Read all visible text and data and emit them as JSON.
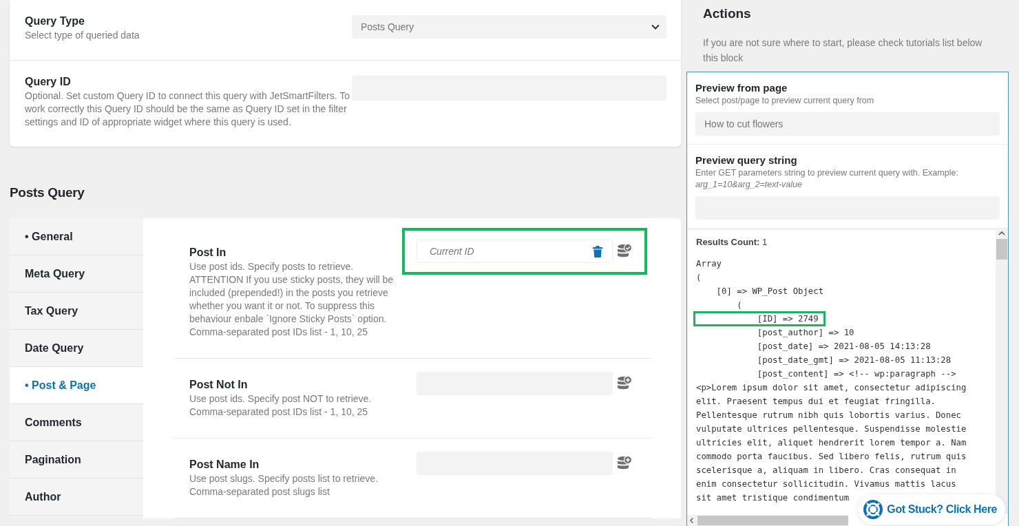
{
  "settings": [
    {
      "title": "Query Type",
      "description": "Select type of queried data",
      "kind": "select",
      "value": "Posts Query"
    },
    {
      "title": "Query ID",
      "description": "Optional. Set custom Query ID to connect this query with JetSmartFilters. To work correctly this Query ID should be the same as Query ID set in the filter settings and ID of appropriate widget where this query is used.",
      "kind": "text"
    }
  ],
  "section_title": "Posts Query",
  "tabs": [
    {
      "label": "• General",
      "selected": false
    },
    {
      "label": "Meta Query",
      "selected": false
    },
    {
      "label": "Tax Query",
      "selected": false
    },
    {
      "label": "Date Query",
      "selected": false
    },
    {
      "label": "• Post & Page",
      "selected": true
    },
    {
      "label": "Comments",
      "selected": false
    },
    {
      "label": "Pagination",
      "selected": false
    },
    {
      "label": "Author",
      "selected": false
    }
  ],
  "fields": [
    {
      "title": "Post In",
      "description": "Use post ids. Specify posts to retrieve. ATTENTION If you use sticky posts, they will be included (prepended!) in the posts you retrieve whether you want it or not. To suppress this behaviour enbale `Ignore Sticky Posts` option. Comma-separated post IDs list - 1, 10, 25",
      "value": "Current ID",
      "macro_applied": true,
      "highlighted": true
    },
    {
      "title": "Post Not In",
      "description": "Use post ids. Specify post NOT to retrieve. Comma-separated post IDs list - 1, 10, 25",
      "macro_applied": false,
      "highlighted": false
    },
    {
      "title": "Post Name In",
      "description": "Use post slugs. Specify posts list to retrieve. Comma-separated post slugs list",
      "macro_applied": false,
      "highlighted": false
    }
  ],
  "actions": {
    "title": "Actions",
    "description": "If you are not sure where to start, please check tutorials list below this block"
  },
  "preview_page": {
    "title": "Preview from page",
    "description": "Select post/page to preview current query from",
    "value": "How to cut flowers"
  },
  "preview_query": {
    "title": "Preview query string",
    "description": "Enter GET parameters string to preview current query with. Example:",
    "example": "arg_1=10&arg_2=text-value"
  },
  "results": {
    "label": "Results Count:",
    "count": "1",
    "lines": [
      {
        "text": "Array",
        "highlighted": false
      },
      {
        "text": "(",
        "highlighted": false
      },
      {
        "text": "    [0] => WP_Post Object",
        "highlighted": false
      },
      {
        "text": "        (",
        "highlighted": false
      },
      {
        "text": "            [ID] => 2749",
        "highlighted": true
      },
      {
        "text": "            [post_author] => 10",
        "highlighted": false
      },
      {
        "text": "            [post_date] => 2021-08-05 14:13:28",
        "highlighted": false
      },
      {
        "text": "            [post_date_gmt] => 2021-08-05 11:13:28",
        "highlighted": false
      },
      {
        "text": "            [post_content] => <!-- wp:paragraph -->",
        "highlighted": false
      },
      {
        "text": "<p>Lorem ipsum dolor sit amet, consectetur adipiscing",
        "highlighted": false
      },
      {
        "text": "elit. Praesent tempus dui et feugiat fringilla.",
        "highlighted": false
      },
      {
        "text": "Pellentesque rutrum nibh quis lobortis varius. Donec",
        "highlighted": false
      },
      {
        "text": "vulputate ultrices pellentesque. Suspendisse molestie",
        "highlighted": false
      },
      {
        "text": "ultricies elit, aliquet hendrerit lorem tempor a. Nam",
        "highlighted": false
      },
      {
        "text": "commodo porta faucibus. Sed libero felis, rutrum quis",
        "highlighted": false
      },
      {
        "text": "scelerisque a, aliquam in libero. Cras consequat in",
        "highlighted": false
      },
      {
        "text": "enim consectetur sollicitudin. Vivamus mattis lacus",
        "highlighted": false
      },
      {
        "text": "sit amet tristique condimentum",
        "highlighted": false
      }
    ]
  },
  "help_button": "Got Stuck? Click Here"
}
